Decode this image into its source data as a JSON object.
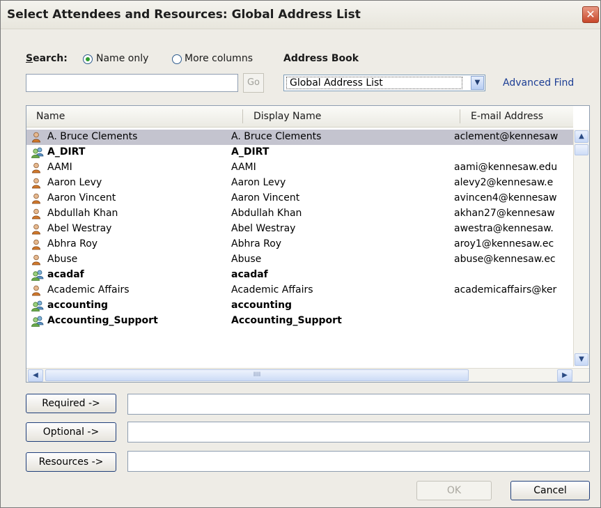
{
  "window": {
    "title": "Select Attendees and Resources: Global Address List",
    "close_glyph": "✕"
  },
  "search": {
    "label": "Search:",
    "radio_name_only": "Name only",
    "radio_more_columns": "More columns",
    "selected_option": "Name only",
    "query_value": "",
    "go_label": "Go"
  },
  "address_book": {
    "label": "Address Book",
    "selected": "Global Address List",
    "advanced_find": "Advanced Find"
  },
  "list": {
    "columns": [
      "Name",
      "Display Name",
      "E-mail Address"
    ],
    "selected_index": 0,
    "rows": [
      {
        "type": "user",
        "name": "A. Bruce Clements",
        "display": "A. Bruce Clements",
        "email": "aclement@kennesaw"
      },
      {
        "type": "group",
        "name": "A_DIRT",
        "display": "A_DIRT",
        "email": ""
      },
      {
        "type": "user",
        "name": "AAMI",
        "display": "AAMI",
        "email": "aami@kennesaw.edu"
      },
      {
        "type": "user",
        "name": "Aaron Levy",
        "display": "Aaron Levy",
        "email": "alevy2@kennesaw.e"
      },
      {
        "type": "user",
        "name": "Aaron Vincent",
        "display": "Aaron Vincent",
        "email": "avincen4@kennesaw"
      },
      {
        "type": "user",
        "name": "Abdullah Khan",
        "display": "Abdullah Khan",
        "email": "akhan27@kennesaw"
      },
      {
        "type": "user",
        "name": "Abel Westray",
        "display": "Abel Westray",
        "email": "awestra@kennesaw."
      },
      {
        "type": "user",
        "name": "Abhra Roy",
        "display": "Abhra Roy",
        "email": "aroy1@kennesaw.ec"
      },
      {
        "type": "user",
        "name": "Abuse",
        "display": "Abuse",
        "email": "abuse@kennesaw.ec"
      },
      {
        "type": "group",
        "name": "acadaf",
        "display": "acadaf",
        "email": ""
      },
      {
        "type": "user",
        "name": "Academic Affairs",
        "display": "Academic Affairs",
        "email": "academicaffairs@ker"
      },
      {
        "type": "group",
        "name": "accounting",
        "display": "accounting",
        "email": ""
      },
      {
        "type": "group",
        "name": "Accounting_Support",
        "display": "Accounting_Support",
        "email": ""
      }
    ],
    "hscroll_grip": "IIII"
  },
  "recipients": {
    "required_label": "Required ->",
    "required_value": "",
    "optional_label": "Optional ->",
    "optional_value": "",
    "resources_label": "Resources ->",
    "resources_value": ""
  },
  "footer": {
    "ok_label": "OK",
    "cancel_label": "Cancel"
  },
  "colors": {
    "selection": "#c4c4cf",
    "link": "#1b3d94",
    "dialog_bg": "#eeece6"
  },
  "icons": {
    "user": "person-icon",
    "group": "group-icon"
  }
}
